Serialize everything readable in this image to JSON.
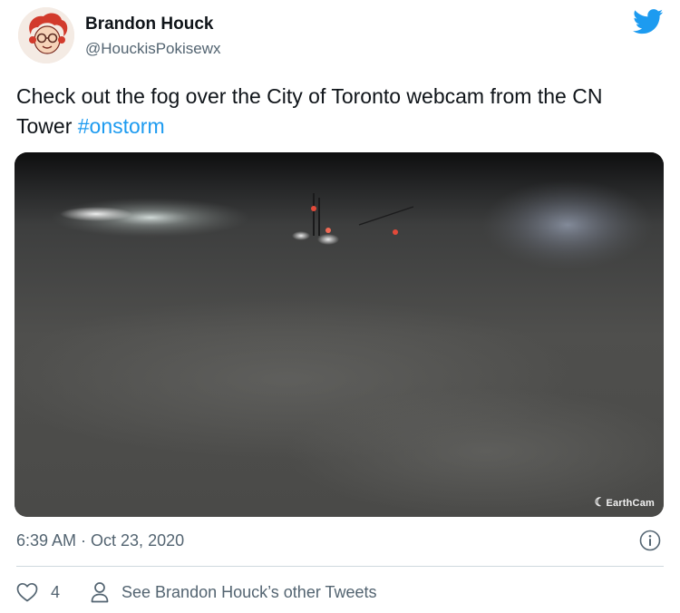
{
  "tweet": {
    "author": {
      "display_name": "Brandon Houck",
      "handle": "@HouckisPokisewx",
      "avatar_icon": "cartoon-avatar-icon"
    },
    "platform_icon": "twitter-bird-icon",
    "text": "Check out the fog over the City of Toronto webcam from the CN Tower ",
    "hashtag": "#onstorm",
    "media": {
      "watermark": "EarthCam",
      "description_icon": "webcam-photo"
    },
    "timestamp": "6:39 AM · Oct 23, 2020",
    "info_icon": "info-icon",
    "actions": {
      "like_count": "4",
      "like_icon": "heart-icon",
      "profile_icon": "person-icon",
      "see_more_label": "See Brandon Houck’s other Tweets"
    }
  },
  "colors": {
    "link": "#1d9bf0",
    "secondary_text": "#536471",
    "divider": "#cfd9de"
  }
}
